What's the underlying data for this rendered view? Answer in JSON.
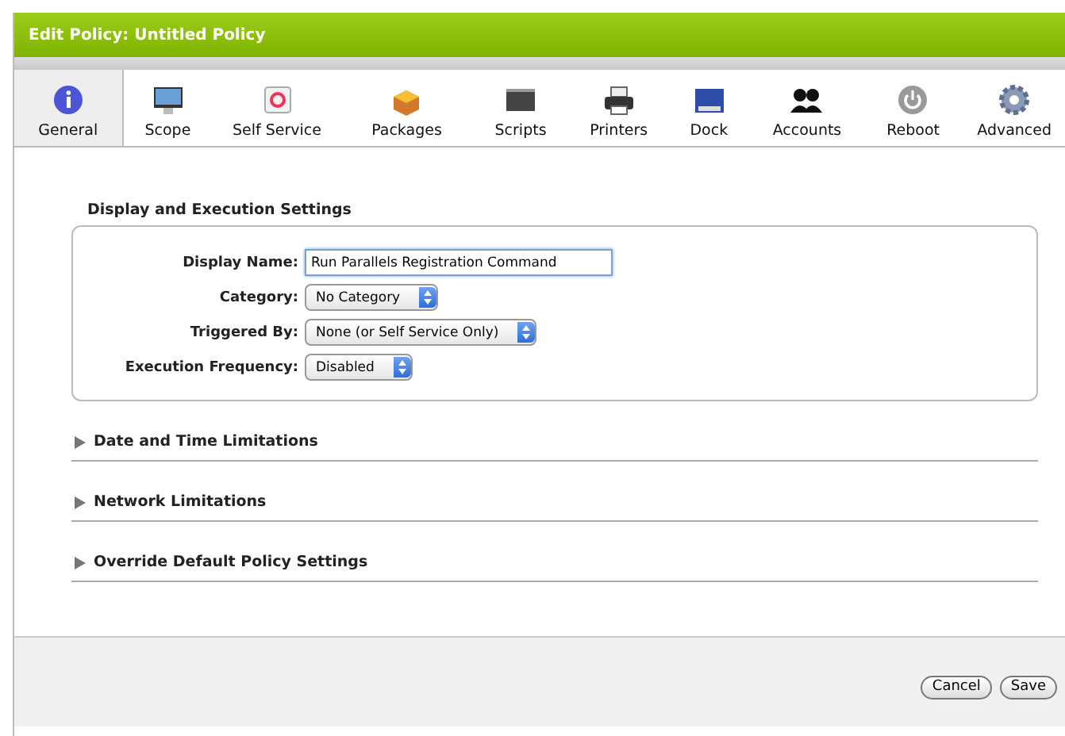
{
  "window": {
    "title": "Edit Policy: Untitled Policy"
  },
  "tabs": [
    {
      "kind": "info",
      "label": "General",
      "selected": true
    },
    {
      "kind": "monitor",
      "label": "Scope",
      "selected": false
    },
    {
      "kind": "selfservice",
      "label": "Self Service",
      "selected": false
    },
    {
      "kind": "package",
      "label": "Packages",
      "selected": false
    },
    {
      "kind": "terminal",
      "label": "Scripts",
      "selected": false
    },
    {
      "kind": "printer",
      "label": "Printers",
      "selected": false
    },
    {
      "kind": "dock",
      "label": "Dock",
      "selected": false
    },
    {
      "kind": "people",
      "label": "Accounts",
      "selected": false
    },
    {
      "kind": "power",
      "label": "Reboot",
      "selected": false
    },
    {
      "kind": "gear",
      "label": "Advanced",
      "selected": false
    }
  ],
  "display_section": {
    "title": "Display and Execution Settings",
    "fields": [
      {
        "kind": "text",
        "label": "Display Name:",
        "value": "Run Parallels Registration Command"
      },
      {
        "kind": "select",
        "label": "Category:",
        "value": "No Category"
      },
      {
        "kind": "select",
        "label": "Triggered By:",
        "value": "None (or Self Service Only)"
      },
      {
        "kind": "select",
        "label": "Execution Frequency:",
        "value": "Disabled"
      }
    ]
  },
  "collapsed_sections": [
    {
      "title": "Date and Time Limitations",
      "expanded": false
    },
    {
      "title": "Network Limitations",
      "expanded": false
    },
    {
      "title": "Override Default Policy Settings",
      "expanded": false
    }
  ],
  "buttons": [
    "Cancel",
    "Save"
  ]
}
